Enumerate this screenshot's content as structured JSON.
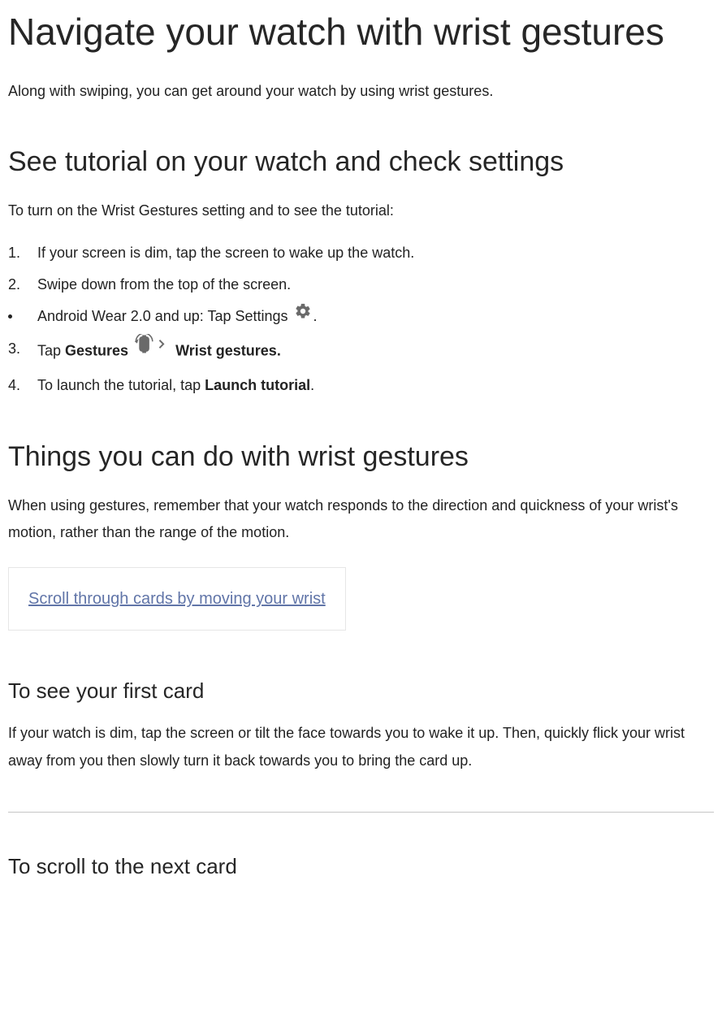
{
  "title": "Navigate your watch with wrist gestures",
  "intro": "Along with swiping, you can get around your watch by using wrist gestures.",
  "section1": {
    "heading": "See tutorial on your watch and check settings",
    "intro": "To turn on the Wrist Gestures setting and to see the tutorial:",
    "steps": {
      "s1": {
        "marker": "1.",
        "text": "If your screen is dim, tap the screen to wake up the watch."
      },
      "s2": {
        "marker": "2.",
        "text": "Swipe down from the top of the screen."
      },
      "s2b": {
        "text_pre": "Android Wear 2.0 and up: Tap Settings ",
        "text_post": "."
      },
      "s3": {
        "marker": "3.",
        "text_pre": "Tap ",
        "bold1": "Gestures",
        "mid": " ",
        "bold2": "Wrist gestures."
      },
      "s4": {
        "marker": "4.",
        "text_pre": "To launch the tutorial, tap ",
        "bold": "Launch tutorial",
        "text_post": "."
      }
    }
  },
  "section2": {
    "heading": "Things you can do with wrist gestures",
    "intro": "When using gestures, remember that your watch responds to the direction and quickness of your wrist's motion, rather than the range of the motion.",
    "expand_label": "Scroll through cards by moving your wrist"
  },
  "section3": {
    "heading": "To see your first card",
    "body": "If your watch is dim, tap the screen or tilt the face towards you to wake it up. Then, quickly flick your wrist away from you then slowly turn it back towards you to bring the card up."
  },
  "section4": {
    "heading": "To scroll to the next card"
  }
}
